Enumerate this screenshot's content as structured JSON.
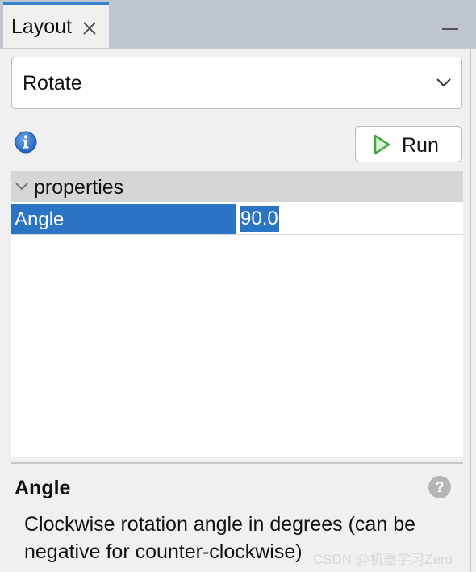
{
  "tab": {
    "label": "Layout"
  },
  "operation_select": {
    "value": "Rotate"
  },
  "run_button": {
    "label": "Run"
  },
  "properties": {
    "group_label": "properties",
    "rows": [
      {
        "name": "Angle",
        "value": "90.0"
      }
    ]
  },
  "description": {
    "title": "Angle",
    "text": "Clockwise rotation angle in degrees (can be negative for counter-clockwise)"
  },
  "watermark": "CSDN @机器学习Zero",
  "icons": {
    "tab_close": "close-icon",
    "select_chevron": "chevron-down-icon",
    "info": "info-icon",
    "run": "play-icon",
    "group_toggle": "chevron-down-icon",
    "help": "help-icon",
    "minimize": "minimize-icon"
  },
  "colors": {
    "accent": "#3a7fd0",
    "selection": "#2b73c5",
    "tabbar_background": "#bfc6cf",
    "panel_background": "#f0f0f0",
    "play_icon": "#3aa83a"
  }
}
